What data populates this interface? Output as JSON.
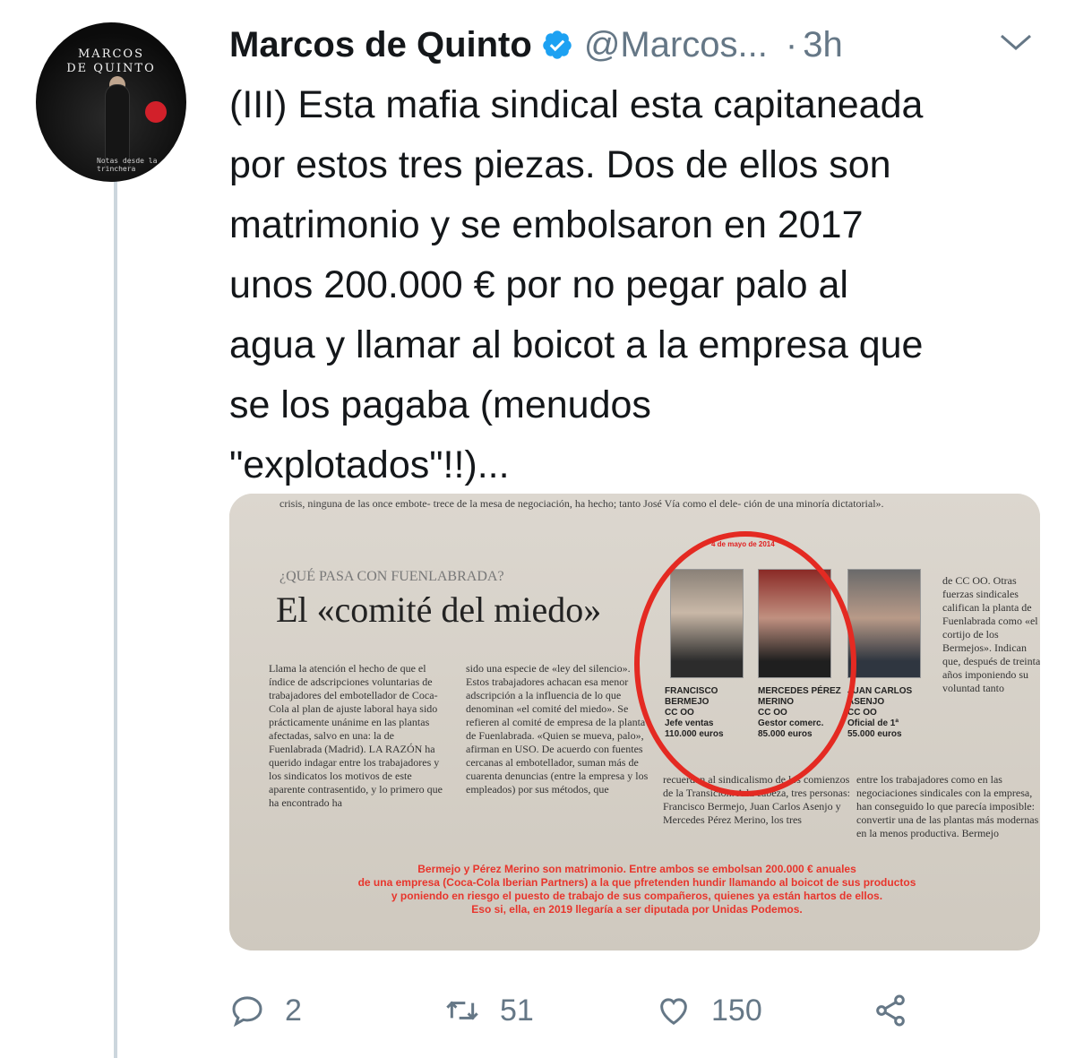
{
  "author": {
    "display_name": "Marcos de Quinto",
    "handle": "@Marcos...",
    "time": "3h",
    "time_separator": "·",
    "avatar": {
      "line1": "MARCOS",
      "line2": "DE QUINTO",
      "caption": "Notas desde la trinchera"
    }
  },
  "tweet": {
    "text": "(III) Esta mafia sindical esta capitaneada\npor estos tres piezas. Dos de ellos son\nmatrimonio y se embolsaron en 2017\nunos 200.000 € por no pegar palo al\nagua y llamar al boicot a la empresa que\nse los pagaba (menudos\n\"explotados\"!!)..."
  },
  "media": {
    "top_text": "crisis, ninguna de las once embote-   trece de la mesa de negociación, ha   hecho; tanto José Vía como el dele-   ción de una minoría dictatorial».",
    "kicker": "¿QUÉ PASA CON FUENLABRADA?",
    "headline": "El «comité del miedo»",
    "date_note": "4 de mayo de 2014",
    "col1": "Llama la atención el hecho de que el índice de adscripciones voluntarias de trabajadores del embotellador de Coca-Cola al plan de ajuste laboral haya sido prácticamente unánime en las plantas afectadas, salvo en una: la de Fuenlabrada (Madrid). LA RAZÓN ha querido indagar entre los trabajadores y los sindicatos los motivos de este aparente contrasentido, y lo primero que ha encontrado ha",
    "col2": "sido una especie de «ley del silencio». Estos trabajadores achacan esa menor adscripción a la influencia de lo que denominan «el comité del miedo». Se refieren al comité de empresa de la planta de Fuenlabrada. «Quien se mueva, palo», afirman en USO. De acuerdo con fuentes cercanas al embotellador, suman más de cuarenta denuncias (entre la empresa y los empleados) por sus métodos, que",
    "col3": "recuerdan al sindicalismo de los comienzos de la Transición. A la cabeza, tres personas: Francisco Bermejo, Juan Carlos Asenjo y Mercedes Pérez Merino, los tres",
    "col4": "entre los trabajadores como en las negociaciones sindicales con la empresa, han conseguido lo que parecía imposible: convertir una de las plantas más modernas en la menos productiva. Bermejo",
    "col5": "de CC OO. Otras fuerzas sindicales califican la planta de Fuenlabrada como «el cortijo de los Bermejos». Indican que, después de treinta años imponiendo su voluntad tanto",
    "caption1": "FRANCISCO BERMEJO\nCC OO\nJefe ventas\n110.000 euros",
    "caption2": "MERCEDES PÉREZ MERINO\nCC OO\nGestor comerc.\n85.000 euros",
    "caption3": "JUAN CARLOS ASENJO\nCC OO\nOficial de 1ª\n55.000 euros",
    "overlay_text": "Bermejo y Pérez Merino son matrimonio. Entre ambos se embolsan 200.000 € anuales\nde una empresa (Coca-Cola Iberian Partners) a la que pfretenden hundir llamando al boicot de sus productos\ny poniendo en riesgo el puesto de trabajo de sus compañeros, quienes ya están hartos de ellos.\nEso si, ella, en 2019 llegaría a ser diputada por Unidas Podemos."
  },
  "actions": {
    "replies": "2",
    "retweets": "51",
    "likes": "150"
  },
  "icons": {
    "verified": "verified-badge-icon",
    "chevron": "chevron-down-icon",
    "reply": "reply-icon",
    "retweet": "retweet-icon",
    "like": "heart-icon",
    "share": "share-icon"
  },
  "colors": {
    "text": "#14171a",
    "secondary": "#657786",
    "verified": "#1da1f2",
    "thread_line": "#ccd6dd",
    "annotation_red": "#e42a22"
  }
}
